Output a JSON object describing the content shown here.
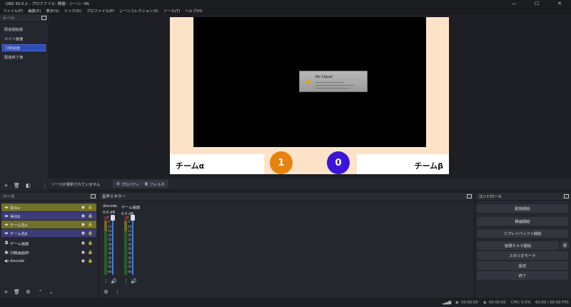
{
  "window": {
    "title": "OBS 30.0.2 - プロファイル: 無題 - シーン: 0N",
    "buttons": [
      "—",
      "☐",
      "✕"
    ]
  },
  "menu": [
    "ファイル(F)",
    "編集(E)",
    "表示(V)",
    "ドック(D)",
    "プロファイル(P)",
    "シーンコレクション(S)",
    "ツール(T)",
    "ヘルプ(H)"
  ],
  "scenes": {
    "header": "シーン",
    "items": [
      {
        "label": "配信開始前",
        "selected": false
      },
      {
        "label": "メイン画面",
        "selected": false
      },
      {
        "label": "対戦画面",
        "selected": true
      },
      {
        "label": "配信終了後",
        "selected": false
      }
    ]
  },
  "preview": {
    "no_signal": "No Signal",
    "team_a": "チームα",
    "team_b": "チームβ",
    "score_a": "1",
    "score_b": "0",
    "score_a_color": "#e8820f",
    "score_b_color": "#3b16d8",
    "canvas_bg": "#fde4c8"
  },
  "context_bar": {
    "message": "ソースが選択されていません",
    "properties": "プロパティ",
    "filters": "フィルタ"
  },
  "sources": {
    "header": "ソース",
    "items": [
      {
        "label": "得点α",
        "icon": "folder-icon",
        "group": "blue"
      },
      {
        "label": "得点β",
        "icon": "folder-icon",
        "group": "blue"
      },
      {
        "label": "チーム名α",
        "icon": "folder-icon",
        "group": "olive"
      },
      {
        "label": "チーム名β",
        "icon": "folder-icon",
        "group": "blue"
      },
      {
        "label": "ゲーム画面",
        "icon": "camera-icon",
        "group": "none"
      },
      {
        "label": "対戦画面枠",
        "icon": "image-icon",
        "group": "none"
      },
      {
        "label": "discode",
        "icon": "speaker-icon",
        "group": "none"
      }
    ]
  },
  "mixer": {
    "header": "音声ミキサー",
    "channels": [
      {
        "name": "discode",
        "db": "0.0 dB"
      },
      {
        "name": "ゲーム画面",
        "db": "0.0 dB"
      }
    ],
    "scale": [
      "0",
      "-5",
      "-10",
      "-15",
      "-20",
      "-25",
      "-30",
      "-35",
      "-40",
      "-45",
      "-50",
      "-55",
      "-60"
    ]
  },
  "controls": {
    "header": "コントロール",
    "buttons": [
      "配信開始",
      "録画開始",
      "リプレイバッファ開始",
      "仮想カメラ開始",
      "スタジオモード",
      "設定",
      "終了"
    ]
  },
  "status": {
    "stream_time": "00:00:00",
    "rec_time": "00:00:00",
    "cpu": "CPU: 0.0%",
    "fps": "60.00 / 60.00 FPS"
  }
}
